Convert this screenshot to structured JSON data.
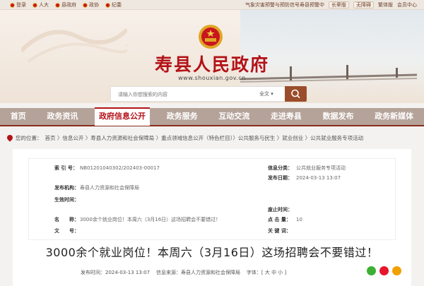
{
  "topbar": {
    "links": [
      "登录",
      "人大",
      "县政府",
      "政协",
      "纪委"
    ],
    "notice": "气象灾害预警与预防信号寿县预警中",
    "elder_mode": "长辈版",
    "accessibility": "无障碍",
    "traditional": "繁体版",
    "member_center": "会员中心"
  },
  "header": {
    "title": "寿县人民政府",
    "url": "www.shouxian.gov.cn",
    "search_placeholder": "请输入你想搜索的内容",
    "search_scope": "全文"
  },
  "nav": {
    "items": [
      "首页",
      "政务资讯",
      "政府信息公开",
      "政务服务",
      "互动交流",
      "走进寿县",
      "数据发布",
      "政务新媒体"
    ],
    "active_index": 2
  },
  "breadcrumb": {
    "prefix": "您的位置：",
    "path": "首页 〉信息公开 〉寿县人力资源和社会保障局 〉重点领域信息公开（特色栏目）〉公共服务与民生 〉就业创业 〉公共就业服务专项活动"
  },
  "meta": {
    "index_no_label": "索 引 号：",
    "index_no": "NB01201040302/202403-00017",
    "info_category_label": "信息分类：",
    "info_category": "公共就业服务专项活动",
    "publisher_label": "发布机构：",
    "publisher": "寿县人力资源和社会保障局",
    "pub_date_label": "发布日期：",
    "pub_date": "2024-03-13 13:07",
    "effective_date_label": "生效时间：",
    "effective_date": "",
    "repeal_date_label": "废止时间：",
    "repeal_date": "",
    "name_label": "名　　称：",
    "name": "3000余个就业岗位！本周六（3月16日）这场招聘会不要错过！",
    "clicks_label": "点 击 量：",
    "clicks": "10",
    "doc_no_label": "文　　号：",
    "doc_no": "",
    "keywords_label": "关 键 词：",
    "keywords": ""
  },
  "article": {
    "title": "3000余个就业岗位！本周六（3月16日）这场招聘会不要错过！",
    "time_label": "发布时间：",
    "time": "2024-03-13 13:07",
    "source_label": "信息来源：",
    "source": "寿县人力资源和社会保障局",
    "font_size_label": "字体：[ 大 中 小 ]"
  },
  "colors": {
    "brand_red": "#b31217",
    "nav_bg": "#b5a399",
    "search_button": "#9a4d2b",
    "share_wechat": "#3cb034",
    "share_weibo": "#e6162d",
    "share_qzone": "#f0a000"
  }
}
